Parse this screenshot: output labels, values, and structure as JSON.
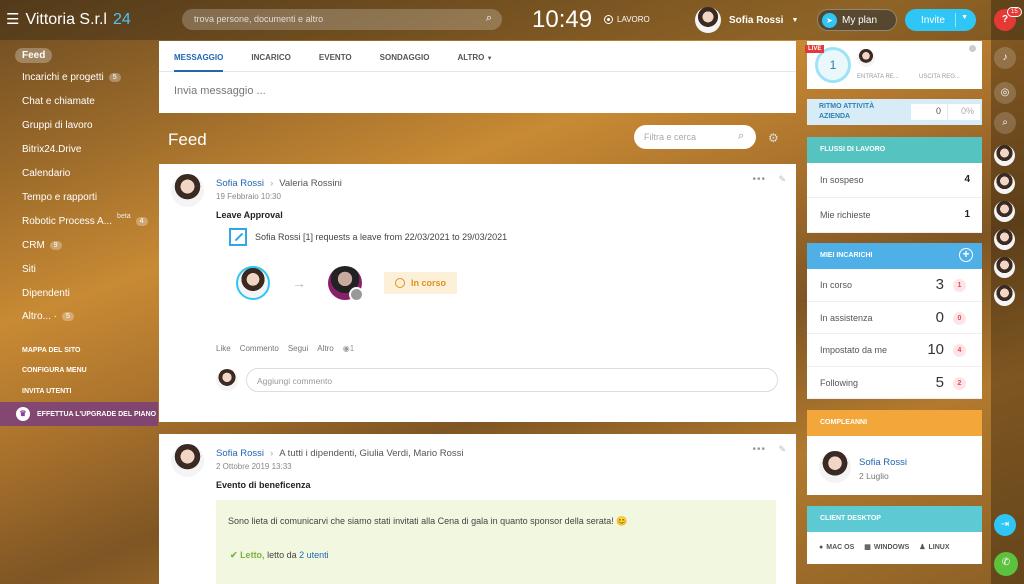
{
  "header": {
    "company": "Vittoria S.r.l",
    "company_num": "24",
    "search_placeholder": "trova persone, documenti e altro",
    "time": "10:49",
    "work_status": "LAVORO",
    "user_name": "Sofia Rossi",
    "plan": "My plan",
    "invite": "Invite",
    "notif_count": "15"
  },
  "sidebar": {
    "items": [
      {
        "label": "Feed",
        "count": ""
      },
      {
        "label": "Incarichi e progetti",
        "count": "5"
      },
      {
        "label": "Chat e chiamate",
        "count": ""
      },
      {
        "label": "Gruppi di lavoro",
        "count": ""
      },
      {
        "label": "Bitrix24.Drive",
        "count": ""
      },
      {
        "label": "Calendario",
        "count": ""
      },
      {
        "label": "Tempo e rapporti",
        "count": ""
      },
      {
        "label": "Robotic Process A...",
        "count": "4",
        "tag": "beta"
      },
      {
        "label": "CRM",
        "count": "9"
      },
      {
        "label": "Siti",
        "count": ""
      },
      {
        "label": "Dipendenti",
        "count": ""
      },
      {
        "label": "Altro... ·",
        "count": "5"
      }
    ],
    "links": [
      "MAPPA DEL SITO",
      "CONFIGURA MENU",
      "INVITA UTENTI"
    ],
    "upgrade": "EFFETTUA L'UPGRADE DEL PIANO"
  },
  "composer": {
    "tabs": [
      "MESSAGGIO",
      "INCARICO",
      "EVENTO",
      "SONDAGGIO",
      "ALTRO"
    ],
    "placeholder": "Invia messaggio ..."
  },
  "feed": {
    "title": "Feed",
    "filter_placeholder": "Filtra e cerca"
  },
  "post1": {
    "author": "Sofia Rossi",
    "recipient": "Valeria Rossini",
    "date": "19 Febbraio 10:30",
    "title": "Leave Approval",
    "request": "Sofia Rossi [1] requests a leave from 22/03/2021 to 29/03/2021",
    "status": "In corso",
    "actions": [
      "Like",
      "Commento",
      "Segui",
      "Altro"
    ],
    "views": "1",
    "comment_placeholder": "Aggiungi commento"
  },
  "post2": {
    "author": "Sofia Rossi",
    "recipient": "A tutti i dipendenti, Giulia Verdi, Mario Rossi",
    "date": "2 Ottobre 2019 13:33",
    "title": "Evento di beneficenza",
    "text": "Sono lieta di comunicarvi che siamo stati invitati alla Cena di gala in quanto sponsor della serata! 😊",
    "read_label": "Letto,",
    "read_by": "letto da",
    "read_users": "2 utenti"
  },
  "right": {
    "timeman": {
      "live": "LIVE",
      "count": "1",
      "entrata": "ENTRATA RE...",
      "uscita": "USCITA REG..."
    },
    "ritmo": {
      "title": "RITMO ATTIVITÀ AZIENDA",
      "value": "0",
      "percent": "0%"
    },
    "flussi": {
      "title": "FLUSSI DI LAVORO",
      "rows": [
        {
          "label": "In sospeso",
          "value": "4"
        },
        {
          "label": "Mie richieste",
          "value": "1"
        }
      ]
    },
    "incarichi": {
      "title": "MIEI INCARICHI",
      "rows": [
        {
          "label": "In corso",
          "value": "3",
          "badge": "1"
        },
        {
          "label": "In assistenza",
          "value": "0",
          "badge": "0"
        },
        {
          "label": "Impostato da me",
          "value": "10",
          "badge": "4"
        },
        {
          "label": "Following",
          "value": "5",
          "badge": "2"
        }
      ]
    },
    "compleanni": {
      "title": "COMPLEANNI",
      "name": "Sofia Rossi",
      "date": "2 Luglio"
    },
    "desktop": {
      "title": "CLIENT DESKTOP",
      "os": [
        "MAC OS",
        "WINDOWS",
        "LINUX"
      ]
    }
  },
  "colors": {
    "accent": "#2fc6f6",
    "link": "#2067b0",
    "teal": "#55c4c0",
    "blue": "#4fb0e8",
    "orange": "#f3a73a",
    "live": "#e53935"
  }
}
